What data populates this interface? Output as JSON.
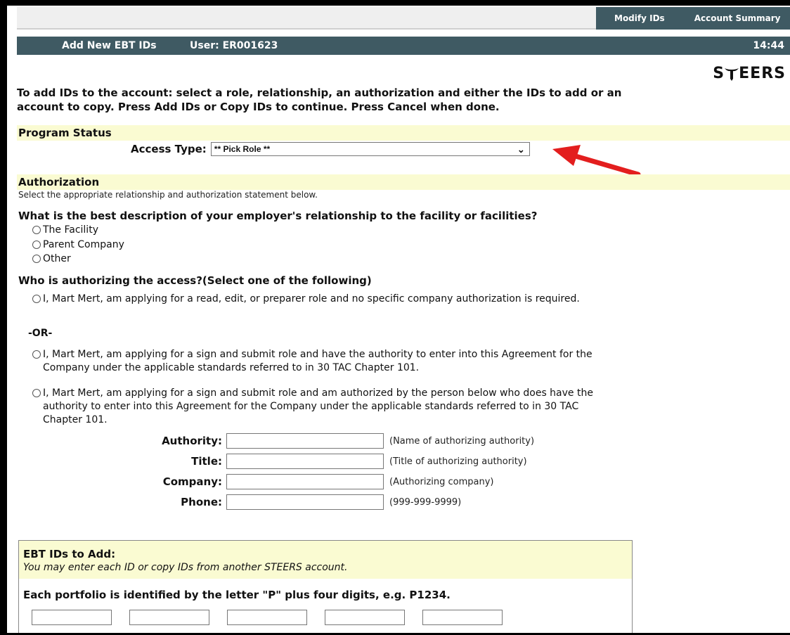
{
  "nav": {
    "modify_ids": "Modify IDs",
    "account_summary": "Account Summary"
  },
  "titlebar": {
    "page_title": "Add New EBT IDs",
    "user": "User: ER001623",
    "time": "14:44"
  },
  "logo": {
    "text": "STEERS"
  },
  "intro": "To add IDs to the account: select a role, relationship, an authorization and either the IDs to add or an account to copy. Press Add IDs or Copy IDs to continue. Press Cancel when done.",
  "program_status": {
    "heading": "Program Status",
    "access_label": "Access Type:",
    "access_value": "** Pick Role **"
  },
  "authorization": {
    "heading": "Authorization",
    "instructions": "Select the appropriate relationship and authorization statement below.",
    "relationship_question": "What is the best description of your employer's relationship to the facility or facilities?",
    "relationship_options": [
      "The Facility",
      "Parent Company",
      "Other"
    ],
    "authorizing_question": "Who is authorizing the access?(Select one of the following)",
    "auth_option_1": "I, Mart Mert, am applying for a read, edit, or preparer role and no specific company authorization is required.",
    "or_text": "-OR-",
    "auth_option_2": "I, Mart Mert, am applying for a sign and submit role and have the authority to enter into this Agreement for the Company under the applicable standards referred to in 30 TAC Chapter 101.",
    "auth_option_3": "I, Mart Mert, am applying for a sign and submit role and am authorized by the person below who does have the authority to enter into this Agreement for the Company under the applicable standards referred to in 30 TAC Chapter 101.",
    "fields": [
      {
        "label": "Authority:",
        "hint": "(Name of authorizing authority)",
        "value": ""
      },
      {
        "label": "Title:",
        "hint": "(Title of authorizing authority)",
        "value": ""
      },
      {
        "label": "Company:",
        "hint": "(Authorizing company)",
        "value": ""
      },
      {
        "label": "Phone:",
        "hint": "(999-999-9999)",
        "value": ""
      }
    ]
  },
  "ebt": {
    "title": "EBT IDs to Add:",
    "subtitle": "You may enter each ID or copy IDs from another STEERS account.",
    "portfolio_note": "Each portfolio is identified by the letter \"P\" plus four digits, e.g. P1234."
  },
  "colors": {
    "header_bg": "#3f5a63",
    "section_bg": "#fafbd2",
    "arrow": "#e31e1e"
  }
}
